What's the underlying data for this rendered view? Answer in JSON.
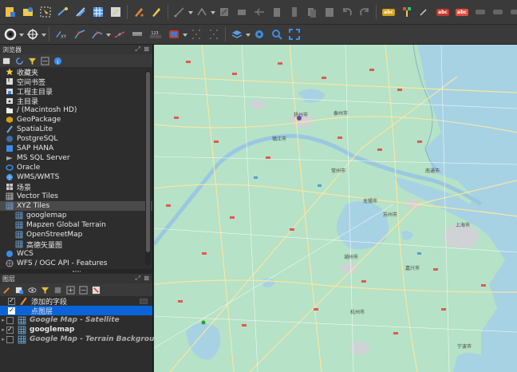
{
  "toolbar1": {
    "icons": [
      "new-project-icon",
      "open-project-icon",
      "select-features-icon",
      "pan-to-selection-icon",
      "pencil-edit-icon",
      "save-edits-icon",
      "digitize-icon",
      "vertex-tool-icon",
      "move-feature-icon",
      "node-tool-icon",
      "delete-icon",
      "cut-icon",
      "copy-icon",
      "paste-icon",
      "undo-icon",
      "redo-icon",
      "abc-label-icon",
      "label-pin-icon",
      "abc-show-icon",
      "abc-highlight-icon"
    ],
    "labels": {
      "abc1": "abc",
      "abc2": "abc",
      "abc3": "abc"
    }
  },
  "toolbar2": {
    "icons": [
      "georef-icon",
      "crosshair-icon",
      "xy-icon",
      "line-digitize-icon",
      "curve-icon",
      "rotate-icon",
      "raster-icon",
      "measure-icon",
      "layer-styling-icon",
      "gear-icon",
      "search-icon",
      "fullscreen-icon"
    ],
    "measure_label": "123"
  },
  "browser_panel": {
    "title": "浏览器",
    "controls": "⤢ ⊠",
    "items": [
      {
        "label": "收藏夹",
        "icon": "star-icon",
        "child": false,
        "selected": false
      },
      {
        "label": "空间书签",
        "icon": "bookmark-icon",
        "child": false,
        "selected": false
      },
      {
        "label": "工程主目录",
        "icon": "folder-home-icon",
        "child": false,
        "selected": false
      },
      {
        "label": "主目录",
        "icon": "home-folder-icon",
        "child": false,
        "selected": false
      },
      {
        "label": "/ (Macintosh HD)",
        "icon": "folder-icon",
        "child": false,
        "selected": false
      },
      {
        "label": "GeoPackage",
        "icon": "geopackage-icon",
        "child": false,
        "selected": false
      },
      {
        "label": "SpatiaLite",
        "icon": "spatialite-icon",
        "child": false,
        "selected": false
      },
      {
        "label": "PostgreSQL",
        "icon": "postgresql-icon",
        "child": false,
        "selected": false
      },
      {
        "label": "SAP HANA",
        "icon": "sap-hana-icon",
        "child": false,
        "selected": false
      },
      {
        "label": "MS SQL Server",
        "icon": "mssql-icon",
        "child": false,
        "selected": false
      },
      {
        "label": "Oracle",
        "icon": "oracle-icon",
        "child": false,
        "selected": false
      },
      {
        "label": "WMS/WMTS",
        "icon": "wms-icon",
        "child": false,
        "selected": false
      },
      {
        "label": "场景",
        "icon": "scene-icon",
        "child": false,
        "selected": false
      },
      {
        "label": "Vector Tiles",
        "icon": "vector-tiles-icon",
        "child": false,
        "selected": false
      },
      {
        "label": "XYZ Tiles",
        "icon": "xyz-tiles-icon",
        "child": false,
        "selected": true
      },
      {
        "label": "googlemap",
        "icon": "tile-grid-icon",
        "child": true,
        "selected": false
      },
      {
        "label": "Mapzen Global Terrain",
        "icon": "tile-grid-icon",
        "child": true,
        "selected": false
      },
      {
        "label": "OpenStreetMap",
        "icon": "tile-grid-icon",
        "child": true,
        "selected": false
      },
      {
        "label": "高德矢量图",
        "icon": "tile-grid-icon",
        "child": true,
        "selected": false
      },
      {
        "label": "WCS",
        "icon": "wcs-icon",
        "child": false,
        "selected": false
      },
      {
        "label": "WFS / OGC API - Features",
        "icon": "wfs-icon",
        "child": false,
        "selected": false
      }
    ]
  },
  "layers_panel": {
    "title": "图层",
    "controls": "⤢ ⊠",
    "layers": [
      {
        "label": "添加的字段",
        "icon": "line-layer-icon",
        "checked": true,
        "selected": false,
        "style": "normal",
        "indent": 1
      },
      {
        "label": "点图层",
        "icon": "",
        "checked": true,
        "selected": true,
        "style": "normal",
        "indent": 1
      },
      {
        "label": "Google Map - Satellite",
        "icon": "tile-layer-icon",
        "checked": false,
        "selected": false,
        "style": "italic",
        "indent": 0
      },
      {
        "label": "googlemap",
        "icon": "tile-layer-icon",
        "checked": true,
        "selected": false,
        "style": "bold",
        "indent": 0
      },
      {
        "label": "Google Map - Terrain Background",
        "icon": "tile-layer-icon",
        "checked": false,
        "selected": false,
        "style": "italic",
        "indent": 0
      }
    ]
  },
  "map": {
    "city_labels": [
      {
        "text": "泰州市"
      },
      {
        "text": "镇江市"
      },
      {
        "text": "常州市"
      },
      {
        "text": "无锡市"
      },
      {
        "text": "苏州市"
      },
      {
        "text": "上海市"
      },
      {
        "text": "南通市"
      },
      {
        "text": "湖州市"
      },
      {
        "text": "嘉兴市"
      },
      {
        "text": "杭州市"
      },
      {
        "text": "宁波市"
      },
      {
        "text": "扬州市"
      }
    ]
  }
}
